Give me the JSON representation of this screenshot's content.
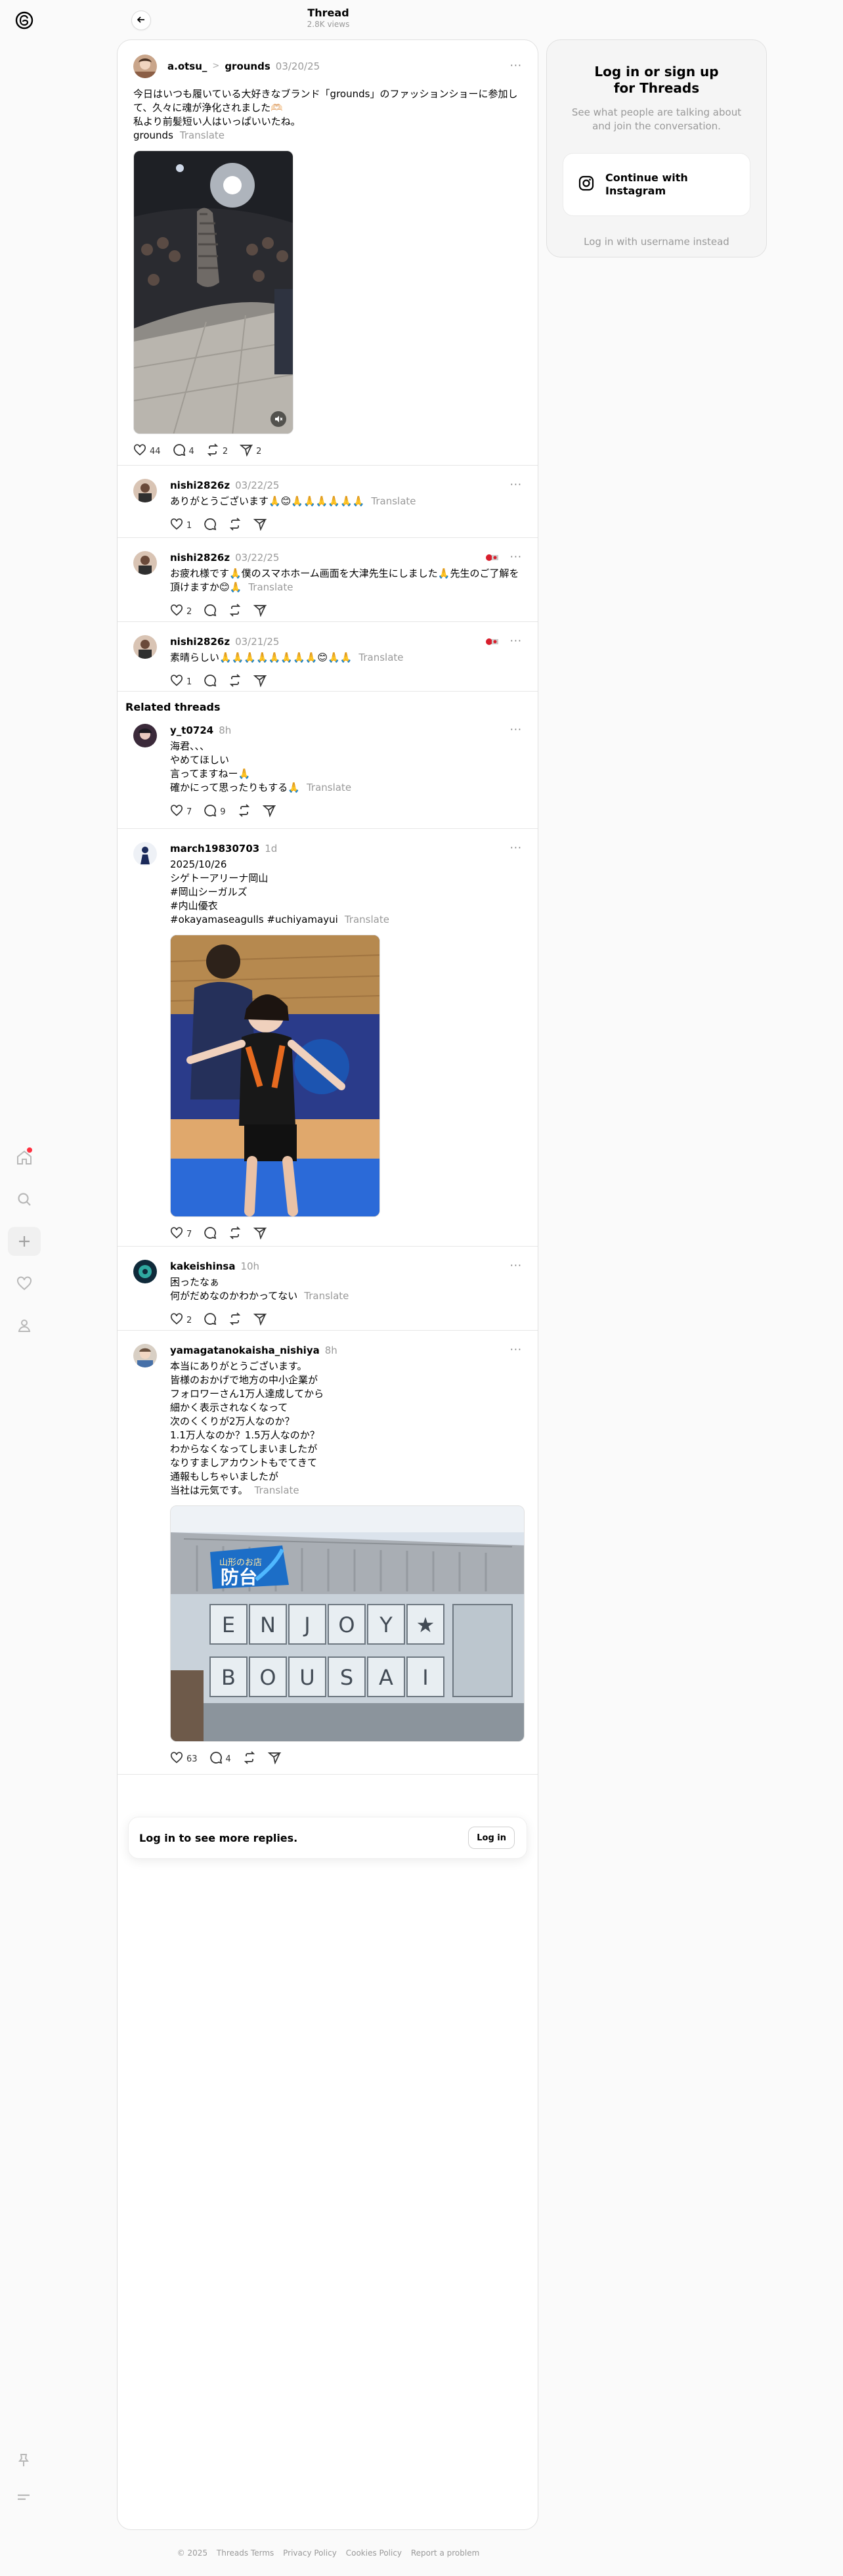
{
  "header": {
    "title": "Thread",
    "views": "2.8K views"
  },
  "main_post": {
    "username": "a.otsu_",
    "community": "grounds",
    "time": "03/20/25",
    "text": "今日はいつも履いている大好きなブランド「grounds」のファッションショーに参加して、久々に魂が浄化されました🫶🏻\n私より前髪短い人はいっぱいいたね。\ngrounds",
    "translate": "Translate",
    "likes": "44",
    "replies": "4",
    "reposts": "2",
    "shares": "2"
  },
  "replies": [
    {
      "username": "nishi2826z",
      "time": "03/22/25",
      "text": "ありがとうございます🙏😊🙏🙏🙏🙏🙏🙏",
      "translate": "Translate",
      "likes": "1"
    },
    {
      "username": "nishi2826z",
      "time": "03/22/25",
      "text": "お疲れ様です🙏僕のスマホホーム画面を大津先生にしました🙏先生のご了解を頂けますか😊🙏",
      "translate": "Translate",
      "likes": "2"
    },
    {
      "username": "nishi2826z",
      "time": "03/21/25",
      "text": "素晴らしい🙏🙏🙏🙏🙏🙏🙏🙏😊🙏🙏",
      "translate": "Translate",
      "likes": "1"
    }
  ],
  "related": {
    "title": "Related threads",
    "posts": [
      {
        "username": "y_t0724",
        "time": "8h",
        "text": "海君、、、\nやめてほしい\n言ってますねー🙏\n確かにって思ったりもする🙏",
        "translate": "Translate",
        "likes": "7",
        "replies": "9"
      },
      {
        "username": "march19830703",
        "time": "1d",
        "text": "2025/10/26\nシゲトーアリーナ岡山\n#岡山シーガルズ\n#内山優衣\n#okayamaseagulls #uchiyamayui",
        "translate": "Translate",
        "likes": "7"
      },
      {
        "username": "kakeishinsa",
        "time": "10h",
        "text": "困ったなぁ\n何がだめなのかわかってない",
        "translate": "Translate",
        "likes": "2"
      },
      {
        "username": "yamagatanokaisha_nishiya",
        "time": "8h",
        "text": "本当にありがとうございます。\n皆様のおかげで地方の中小企業が\nフォロワーさん1万人達成してから\n細かく表示されなくなって\n次のくくりが2万人なのか？\n1.1万人なのか？1.5万人なのか？\nわからなくなってしまいましたが\nなりすましアカウントもでてきて\n通報もしちゃいましたが\n当社は元気です。",
        "translate": "Translate",
        "likes": "63",
        "replies": "4"
      }
    ]
  },
  "login_bar": {
    "text": "Log in to see more replies.",
    "button": "Log in"
  },
  "sidebar_card": {
    "title": "Log in or sign up for Threads",
    "desc": "See what people are talking about and join the conversation.",
    "instagram_button": "Continue with Instagram",
    "username_link": "Log in with username instead"
  },
  "footer": [
    "© 2025",
    "Threads Terms",
    "Privacy Policy",
    "Cookies Policy",
    "Report a problem"
  ],
  "store_sign": {
    "top": "山形のお店",
    "middle": "防台",
    "row1": [
      "E",
      "N",
      "J",
      "O",
      "Y",
      "★"
    ],
    "row2": [
      "B",
      "O",
      "U",
      "S",
      "A",
      "I"
    ]
  },
  "colors": {
    "notification": "#ff3040",
    "muted": "#999999",
    "border": "#e6e6e6"
  },
  "icons": [
    "threads-logo-icon",
    "home-icon",
    "search-icon",
    "plus-icon",
    "heart-icon",
    "profile-icon",
    "pin-icon",
    "menu-icon",
    "back-arrow-icon",
    "more-icon",
    "instagram-icon",
    "repost-icon",
    "share-icon",
    "comment-icon",
    "mute-icon",
    "flag-icon"
  ]
}
